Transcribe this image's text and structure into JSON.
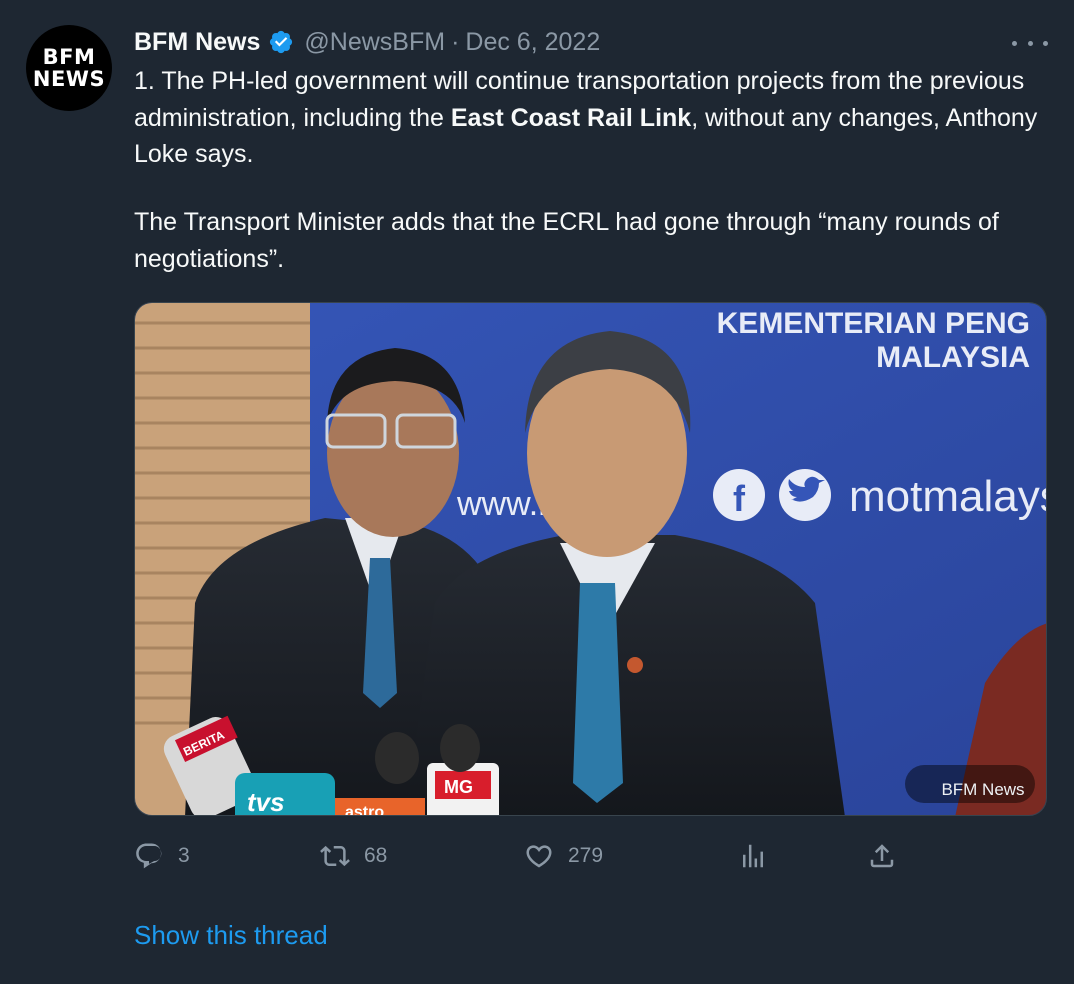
{
  "account": {
    "avatar_line1": "BFM",
    "avatar_line2": "NEWS",
    "display_name": "BFM News",
    "verified_icon": "verified-badge-icon",
    "handle": "@NewsBFM",
    "separator": "·",
    "date": "Dec 6, 2022"
  },
  "tweet": {
    "para1_before": "1. The PH-led government will continue transportation projects from the previous administration, including the ",
    "para1_bold": "East Coast Rail Link",
    "para1_after": ", without any changes, Anthony Loke says.",
    "para2": "The Transport Minister adds that the ECRL had gone through “many rounds of negotiations”."
  },
  "media": {
    "backdrop_line1": "KEMENTERIAN PENG",
    "backdrop_line2": "MALAYSIA",
    "backdrop_social": "motmalaysi",
    "backdrop_url": "www.m",
    "mic_label_1": "BERITA",
    "mic_label_2": "tvs",
    "mic_label_3": "MG",
    "mic_label_4": "astro",
    "credit": "BFM News"
  },
  "actions": {
    "reply_count": "3",
    "retweet_count": "68",
    "like_count": "279",
    "reply_icon": "reply-icon",
    "retweet_icon": "retweet-icon",
    "like_icon": "heart-icon",
    "views_icon": "analytics-icon",
    "share_icon": "share-icon"
  },
  "footer": {
    "show_thread": "Show this thread"
  },
  "colors": {
    "background": "#1e2732",
    "text": "#f7f9f9",
    "muted": "#8b98a5",
    "accent": "#1d9bf0"
  }
}
